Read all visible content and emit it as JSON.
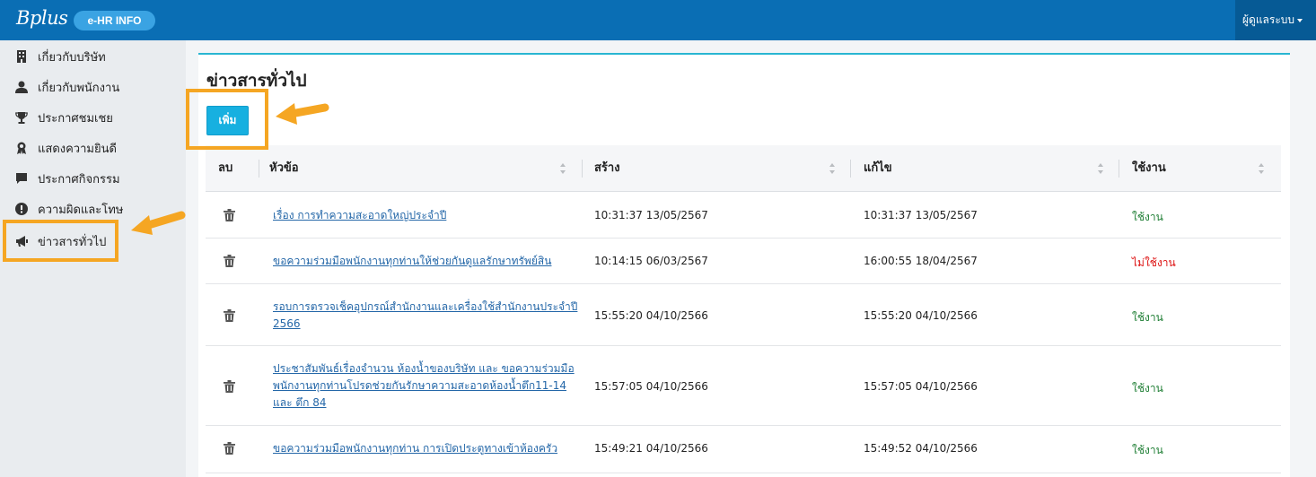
{
  "header": {
    "logo": "Bplus",
    "badge": "e-HR INFO",
    "user_menu": "ผู้ดูแลระบบ"
  },
  "sidebar": {
    "items": [
      {
        "label": "เกี่ยวกับบริษัท",
        "icon": "building-icon"
      },
      {
        "label": "เกี่ยวกับพนักงาน",
        "icon": "user-icon"
      },
      {
        "label": "ประกาศชมเชย",
        "icon": "trophy-icon"
      },
      {
        "label": "แสดงความยินดี",
        "icon": "award-icon"
      },
      {
        "label": "ประกาศกิจกรรม",
        "icon": "comment-icon"
      },
      {
        "label": "ความผิดและโทษ",
        "icon": "exclamation-circle-icon"
      },
      {
        "label": "ข่าวสารทั่วไป",
        "icon": "megaphone-icon",
        "active": true
      }
    ]
  },
  "main": {
    "title": "ข่าวสารทั่วไป",
    "add_button": "เพิ่ม"
  },
  "table": {
    "columns": {
      "delete": "ลบ",
      "topic": "หัวข้อ",
      "created": "สร้าง",
      "modified": "แก้ไข",
      "status": "ใช้งาน"
    },
    "rows": [
      {
        "topic": "เรื่อง การทำความสะอาดใหญ่ประจำปี",
        "created": "10:31:37 13/05/2567",
        "modified": "10:31:37 13/05/2567",
        "status": "ใช้งาน"
      },
      {
        "topic": "ขอความร่วมมือพนักงานทุกท่านให้ช่วยกันดูแลรักษาทรัพย์สิน",
        "created": "10:14:15 06/03/2567",
        "modified": "16:00:55 18/04/2567",
        "status": "ไม่ใช้งาน"
      },
      {
        "topic": "รอบการตรวจเช็คอุปกรณ์สำนักงานและเครื่องใช้สำนักงานประจำปี 2566",
        "created": "15:55:20 04/10/2566",
        "modified": "15:55:20 04/10/2566",
        "status": "ใช้งาน"
      },
      {
        "topic": "ประชาสัมพันธ์เรื่องจำนวน ห้องน้ำของบริษัท และ ขอความร่วมมือพนักงานทุกท่านโปรดช่วยกันรักษาความสะอาดห้องน้ำตึก11-14 และ ตึก 84",
        "created": "15:57:05 04/10/2566",
        "modified": "15:57:05 04/10/2566",
        "status": "ใช้งาน"
      },
      {
        "topic": "ขอความร่วมมือพนักงานทุกท่าน การเปิดประตูทางเข้าห้องครัว",
        "created": "15:49:21 04/10/2566",
        "modified": "15:49:52 04/10/2566",
        "status": "ใช้งาน"
      }
    ]
  },
  "colors": {
    "header_bg": "#0a6eb4",
    "accent": "#17b0e0",
    "annotation": "#f5a623",
    "status_active": "#1e7e34",
    "status_inactive": "#dd1111"
  }
}
